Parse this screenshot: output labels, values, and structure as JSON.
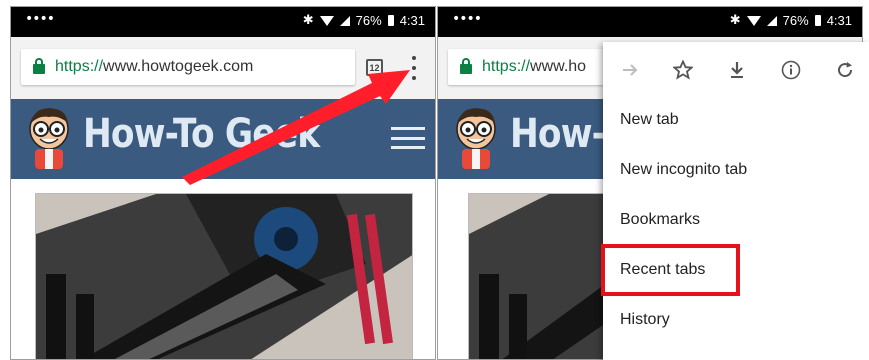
{
  "status_bar": {
    "signal_dots": "••••",
    "battery_pct": "76%",
    "time": "4:31"
  },
  "browser": {
    "url_scheme": "https://",
    "url_host": "www.howtogeek.com",
    "url_host_truncated": "www.ho",
    "tab_count": "12"
  },
  "site": {
    "title": "How-To Geek",
    "title_truncated": "How-"
  },
  "menu": {
    "icons": [
      "forward-icon",
      "star-icon",
      "download-icon",
      "info-icon",
      "reload-icon"
    ],
    "items": [
      {
        "label": "New tab"
      },
      {
        "label": "New incognito tab"
      },
      {
        "label": "Bookmarks"
      },
      {
        "label": "Recent tabs"
      },
      {
        "label": "History"
      }
    ],
    "highlighted_item": "Recent tabs"
  },
  "colors": {
    "header_blue": "#3a5a80",
    "lock_green": "#0b8043",
    "highlight_red": "#e3121b",
    "arrow_red": "#ff1e2a"
  }
}
